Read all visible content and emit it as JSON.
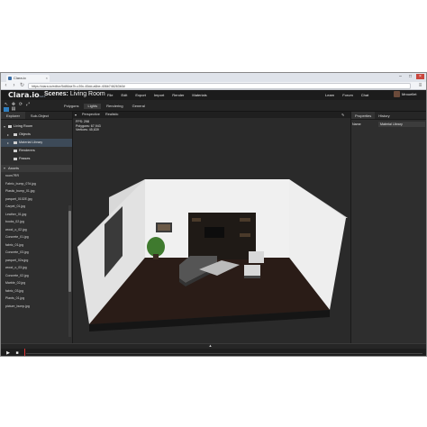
{
  "browser": {
    "tab_title": "Clara.io",
    "tab_close": "×",
    "url": "https://clara.io/editor/5d86da7b-c39c-45dd-a6be-406b746263b0#",
    "window_controls": [
      "–",
      "□",
      "×"
    ],
    "nav_icons": [
      "back-icon",
      "forward-icon",
      "reload-icon"
    ]
  },
  "app": {
    "logo": "Clara.io",
    "logo_suffix": "beta",
    "scene_label": "Scenes:",
    "scene_name": "Living Room",
    "menu": [
      "File",
      "Edit",
      "Export",
      "Import",
      "Render",
      "Materials"
    ],
    "right_menu": [
      "Learn",
      "Forum",
      "Chat"
    ],
    "user_name": "Mrouellet"
  },
  "toolbar": {
    "tabs": [
      "Polygons",
      "Lights",
      "Rendering",
      "General"
    ],
    "active_tab": "Lights"
  },
  "left_panel": {
    "tabs": [
      "Explorer",
      "Sub-Object"
    ],
    "tree": [
      {
        "label": "Living Room",
        "indent": 0,
        "arrow": "▾"
      },
      {
        "label": "Objects",
        "indent": 1,
        "arrow": "▸"
      },
      {
        "label": "Material Library",
        "indent": 1,
        "arrow": "▸",
        "selected": true
      },
      {
        "label": "Renderers",
        "indent": 2,
        "arrow": ""
      },
      {
        "label": "Passes",
        "indent": 2,
        "arrow": ""
      }
    ],
    "assets_label": "Assets",
    "assets": [
      "room7RR",
      "Fabric_bump_07d.jpg",
      "Plastic_bump_01.jpg",
      "parquet_0102E.jpg",
      "Carpet_01.jpg",
      "Leather_01.jpg",
      "books_02.jpg",
      "wood_o_02.jpg",
      "Concrete_01.jpg",
      "fabric_01.jpg",
      "Concrete_03.jpg",
      "parquet_02a.jpg",
      "wood_o_03.jpg",
      "Concrete_02.jpg",
      "Marble_02.jpg",
      "fabric_03.jpg",
      "Plants_01.jpg",
      "picture_bump.jpg"
    ]
  },
  "viewport": {
    "view_mode": "Perspective",
    "shading": "Realistic",
    "stats": {
      "fps": "FPS: 298",
      "polygons": "Polygons: 67,943",
      "vertices": "Vertices: 45,639"
    }
  },
  "right_panel": {
    "tabs": [
      "Properties",
      "History"
    ],
    "props": [
      {
        "label": "Name",
        "value": "Material Library"
      }
    ]
  },
  "timeline": {
    "handle": "▲",
    "play": "▶",
    "stop": "■"
  },
  "colors": {
    "accent": "#2f7fc1",
    "floor": "#2a1c17",
    "wall": "#e9e9e9",
    "close_button": "#c9463d"
  }
}
